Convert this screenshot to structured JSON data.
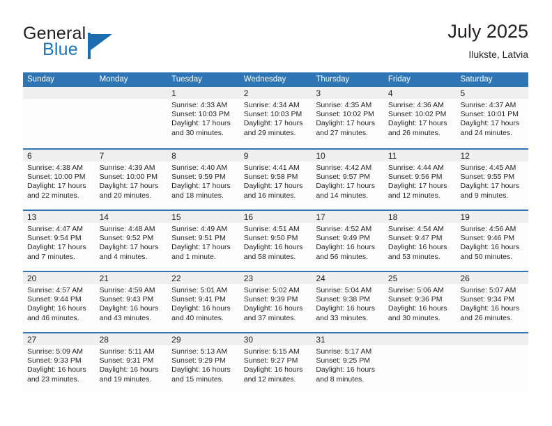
{
  "brand": {
    "name_part1": "General",
    "name_part2": "Blue",
    "logo_icon": "blue-triangle-logo"
  },
  "header": {
    "title": "July 2025",
    "subtitle": "Ilukste, Latvia"
  },
  "calendar": {
    "weekday_headers": [
      "Sunday",
      "Monday",
      "Tuesday",
      "Wednesday",
      "Thursday",
      "Friday",
      "Saturday"
    ],
    "header_bg": "#2e75b6",
    "day_band_bg": "#efefef",
    "weeks": [
      [
        {
          "day": "",
          "lines": []
        },
        {
          "day": "",
          "lines": []
        },
        {
          "day": "1",
          "lines": [
            "Sunrise: 4:33 AM",
            "Sunset: 10:03 PM",
            "Daylight: 17 hours",
            "and 30 minutes."
          ]
        },
        {
          "day": "2",
          "lines": [
            "Sunrise: 4:34 AM",
            "Sunset: 10:03 PM",
            "Daylight: 17 hours",
            "and 29 minutes."
          ]
        },
        {
          "day": "3",
          "lines": [
            "Sunrise: 4:35 AM",
            "Sunset: 10:02 PM",
            "Daylight: 17 hours",
            "and 27 minutes."
          ]
        },
        {
          "day": "4",
          "lines": [
            "Sunrise: 4:36 AM",
            "Sunset: 10:02 PM",
            "Daylight: 17 hours",
            "and 26 minutes."
          ]
        },
        {
          "day": "5",
          "lines": [
            "Sunrise: 4:37 AM",
            "Sunset: 10:01 PM",
            "Daylight: 17 hours",
            "and 24 minutes."
          ]
        }
      ],
      [
        {
          "day": "6",
          "lines": [
            "Sunrise: 4:38 AM",
            "Sunset: 10:00 PM",
            "Daylight: 17 hours",
            "and 22 minutes."
          ]
        },
        {
          "day": "7",
          "lines": [
            "Sunrise: 4:39 AM",
            "Sunset: 10:00 PM",
            "Daylight: 17 hours",
            "and 20 minutes."
          ]
        },
        {
          "day": "8",
          "lines": [
            "Sunrise: 4:40 AM",
            "Sunset: 9:59 PM",
            "Daylight: 17 hours",
            "and 18 minutes."
          ]
        },
        {
          "day": "9",
          "lines": [
            "Sunrise: 4:41 AM",
            "Sunset: 9:58 PM",
            "Daylight: 17 hours",
            "and 16 minutes."
          ]
        },
        {
          "day": "10",
          "lines": [
            "Sunrise: 4:42 AM",
            "Sunset: 9:57 PM",
            "Daylight: 17 hours",
            "and 14 minutes."
          ]
        },
        {
          "day": "11",
          "lines": [
            "Sunrise: 4:44 AM",
            "Sunset: 9:56 PM",
            "Daylight: 17 hours",
            "and 12 minutes."
          ]
        },
        {
          "day": "12",
          "lines": [
            "Sunrise: 4:45 AM",
            "Sunset: 9:55 PM",
            "Daylight: 17 hours",
            "and 9 minutes."
          ]
        }
      ],
      [
        {
          "day": "13",
          "lines": [
            "Sunrise: 4:47 AM",
            "Sunset: 9:54 PM",
            "Daylight: 17 hours",
            "and 7 minutes."
          ]
        },
        {
          "day": "14",
          "lines": [
            "Sunrise: 4:48 AM",
            "Sunset: 9:52 PM",
            "Daylight: 17 hours",
            "and 4 minutes."
          ]
        },
        {
          "day": "15",
          "lines": [
            "Sunrise: 4:49 AM",
            "Sunset: 9:51 PM",
            "Daylight: 17 hours",
            "and 1 minute."
          ]
        },
        {
          "day": "16",
          "lines": [
            "Sunrise: 4:51 AM",
            "Sunset: 9:50 PM",
            "Daylight: 16 hours",
            "and 58 minutes."
          ]
        },
        {
          "day": "17",
          "lines": [
            "Sunrise: 4:52 AM",
            "Sunset: 9:49 PM",
            "Daylight: 16 hours",
            "and 56 minutes."
          ]
        },
        {
          "day": "18",
          "lines": [
            "Sunrise: 4:54 AM",
            "Sunset: 9:47 PM",
            "Daylight: 16 hours",
            "and 53 minutes."
          ]
        },
        {
          "day": "19",
          "lines": [
            "Sunrise: 4:56 AM",
            "Sunset: 9:46 PM",
            "Daylight: 16 hours",
            "and 50 minutes."
          ]
        }
      ],
      [
        {
          "day": "20",
          "lines": [
            "Sunrise: 4:57 AM",
            "Sunset: 9:44 PM",
            "Daylight: 16 hours",
            "and 46 minutes."
          ]
        },
        {
          "day": "21",
          "lines": [
            "Sunrise: 4:59 AM",
            "Sunset: 9:43 PM",
            "Daylight: 16 hours",
            "and 43 minutes."
          ]
        },
        {
          "day": "22",
          "lines": [
            "Sunrise: 5:01 AM",
            "Sunset: 9:41 PM",
            "Daylight: 16 hours",
            "and 40 minutes."
          ]
        },
        {
          "day": "23",
          "lines": [
            "Sunrise: 5:02 AM",
            "Sunset: 9:39 PM",
            "Daylight: 16 hours",
            "and 37 minutes."
          ]
        },
        {
          "day": "24",
          "lines": [
            "Sunrise: 5:04 AM",
            "Sunset: 9:38 PM",
            "Daylight: 16 hours",
            "and 33 minutes."
          ]
        },
        {
          "day": "25",
          "lines": [
            "Sunrise: 5:06 AM",
            "Sunset: 9:36 PM",
            "Daylight: 16 hours",
            "and 30 minutes."
          ]
        },
        {
          "day": "26",
          "lines": [
            "Sunrise: 5:07 AM",
            "Sunset: 9:34 PM",
            "Daylight: 16 hours",
            "and 26 minutes."
          ]
        }
      ],
      [
        {
          "day": "27",
          "lines": [
            "Sunrise: 5:09 AM",
            "Sunset: 9:33 PM",
            "Daylight: 16 hours",
            "and 23 minutes."
          ]
        },
        {
          "day": "28",
          "lines": [
            "Sunrise: 5:11 AM",
            "Sunset: 9:31 PM",
            "Daylight: 16 hours",
            "and 19 minutes."
          ]
        },
        {
          "day": "29",
          "lines": [
            "Sunrise: 5:13 AM",
            "Sunset: 9:29 PM",
            "Daylight: 16 hours",
            "and 15 minutes."
          ]
        },
        {
          "day": "30",
          "lines": [
            "Sunrise: 5:15 AM",
            "Sunset: 9:27 PM",
            "Daylight: 16 hours",
            "and 12 minutes."
          ]
        },
        {
          "day": "31",
          "lines": [
            "Sunrise: 5:17 AM",
            "Sunset: 9:25 PM",
            "Daylight: 16 hours",
            "and 8 minutes."
          ]
        },
        {
          "day": "",
          "lines": []
        },
        {
          "day": "",
          "lines": []
        }
      ]
    ]
  }
}
